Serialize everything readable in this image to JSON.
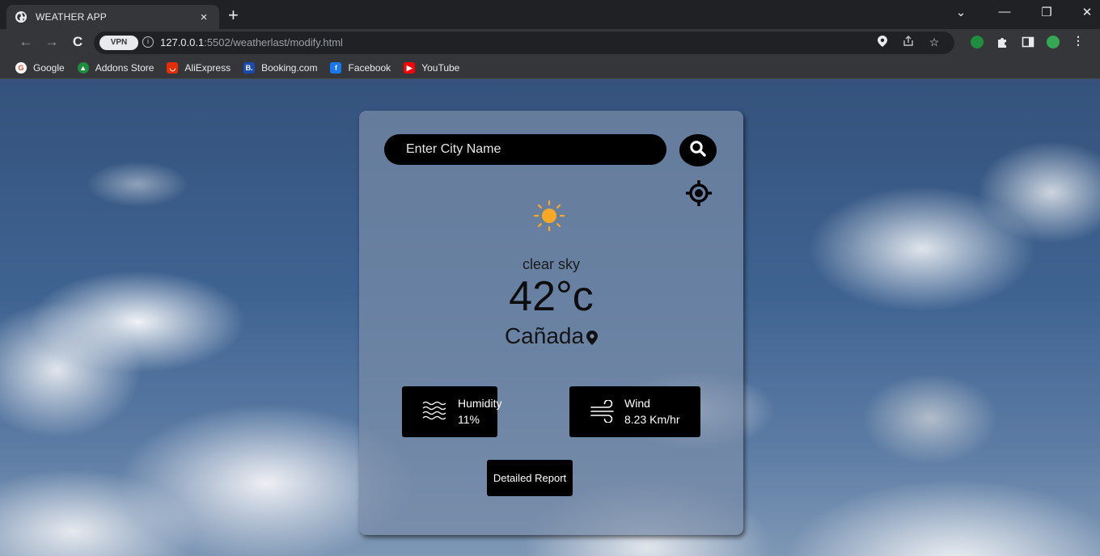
{
  "browser": {
    "tab": {
      "title": "WEATHER APP",
      "close_glyph": "×"
    },
    "new_tab_glyph": "+",
    "window_controls": {
      "tab_search": "⌄",
      "minimize": "—",
      "restore": "❐",
      "close": "✕"
    },
    "nav": {
      "back": "←",
      "forward": "→",
      "reload": "C"
    },
    "address": {
      "vpn_label": "VPN",
      "host": "127.0.0.1",
      "path": ":5502/weatherlast/modify.html"
    },
    "bookmarks": [
      {
        "label": "Google",
        "icon": "google-icon",
        "color": "#ea4335"
      },
      {
        "label": "Addons Store",
        "icon": "addons-store-icon",
        "color": "#1e8e3e"
      },
      {
        "label": "AliExpress",
        "icon": "aliexpress-icon",
        "color": "#e62e04"
      },
      {
        "label": "Booking.com",
        "icon": "booking-icon",
        "color": "#1a4cb0"
      },
      {
        "label": "Facebook",
        "icon": "facebook-icon",
        "color": "#1877f2"
      },
      {
        "label": "YouTube",
        "icon": "youtube-icon",
        "color": "#ff0000"
      }
    ]
  },
  "app": {
    "search": {
      "placeholder": "Enter City Name",
      "value": ""
    },
    "weather": {
      "description": "clear sky",
      "temperature": "42",
      "unit": "°c",
      "city": "Cañada",
      "icon": "sun-icon"
    },
    "humidity": {
      "label": "Humidity",
      "value": "11%"
    },
    "wind": {
      "label": "Wind",
      "value": "8.23 Km/hr"
    },
    "report_button": "Detailed Report"
  },
  "colors": {
    "card": "#788ca8",
    "panel": "#000000",
    "sun": "#f9a825",
    "sky": "#3f6391"
  }
}
